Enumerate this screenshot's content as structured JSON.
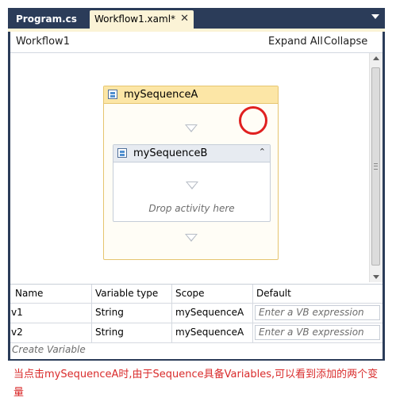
{
  "tabs": [
    {
      "label": "Program.cs",
      "active": false
    },
    {
      "label": "Workflow1.xaml*",
      "active": true
    }
  ],
  "tab_close_glyph": "✕",
  "designer": {
    "title": "Workflow1",
    "expand_all": "Expand All",
    "collapse_all": "Collapse All"
  },
  "sequence_a": {
    "label": "mySequenceA"
  },
  "sequence_b": {
    "label": "mySequenceB",
    "drop_hint": "Drop activity here",
    "collapse_glyph": "⌃"
  },
  "variables": {
    "columns": [
      "Name",
      "Variable type",
      "Scope",
      "Default"
    ],
    "rows": [
      {
        "name": "v1",
        "type": "String",
        "scope": "mySequenceA",
        "default_placeholder": "Enter a VB expression"
      },
      {
        "name": "v2",
        "type": "String",
        "scope": "mySequenceA",
        "default_placeholder": "Enter a VB expression"
      }
    ],
    "create_label": "Create Variable"
  },
  "annotation": {
    "text": "当点击mySequenceA时,由于Sequence具备Variables,可以看到添加的两个变量"
  },
  "colors": {
    "tab_bar": "#2b3c59",
    "active_tab": "#fbf3d6",
    "selected_header": "#fce6a6",
    "selected_border": "#e6c56f",
    "annotation_red": "#e02020"
  },
  "icons": [
    "sequence-icon",
    "collapse-chevrons-icon",
    "close-icon",
    "dropdown-arrow-icon",
    "drop-target-arrow-icon"
  ]
}
